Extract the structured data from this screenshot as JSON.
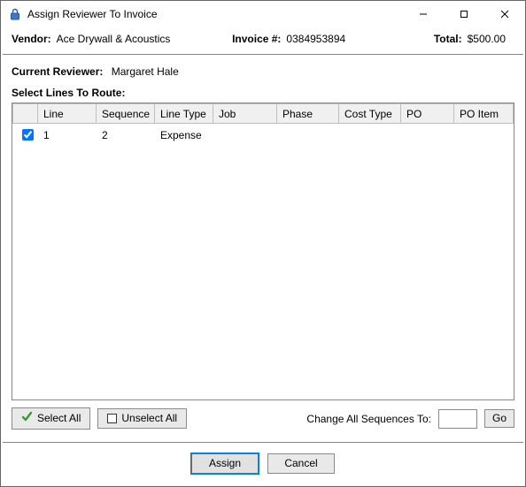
{
  "window": {
    "title": "Assign Reviewer To Invoice"
  },
  "info": {
    "vendor_label": "Vendor:",
    "vendor_value": "Ace Drywall & Acoustics",
    "invoice_label": "Invoice #:",
    "invoice_value": "0384953894",
    "total_label": "Total:",
    "total_value": "$500.00"
  },
  "reviewer": {
    "label": "Current Reviewer:",
    "value": "Margaret Hale"
  },
  "section": {
    "select_lines_label": "Select Lines To Route:"
  },
  "table": {
    "headers": {
      "check": "",
      "line": "Line",
      "sequence": "Sequence",
      "linetype": "Line Type",
      "job": "Job",
      "phase": "Phase",
      "costtype": "Cost Type",
      "po": "PO",
      "poitem": "PO Item"
    },
    "rows": [
      {
        "checked": true,
        "line": "1",
        "sequence": "2",
        "linetype": "Expense",
        "job": "",
        "phase": "",
        "costtype": "",
        "po": "",
        "poitem": ""
      }
    ]
  },
  "buttons": {
    "select_all": "Select All",
    "unselect_all": "Unselect All",
    "change_seq_label": "Change All Sequences To:",
    "go": "Go",
    "assign": "Assign",
    "cancel": "Cancel"
  }
}
